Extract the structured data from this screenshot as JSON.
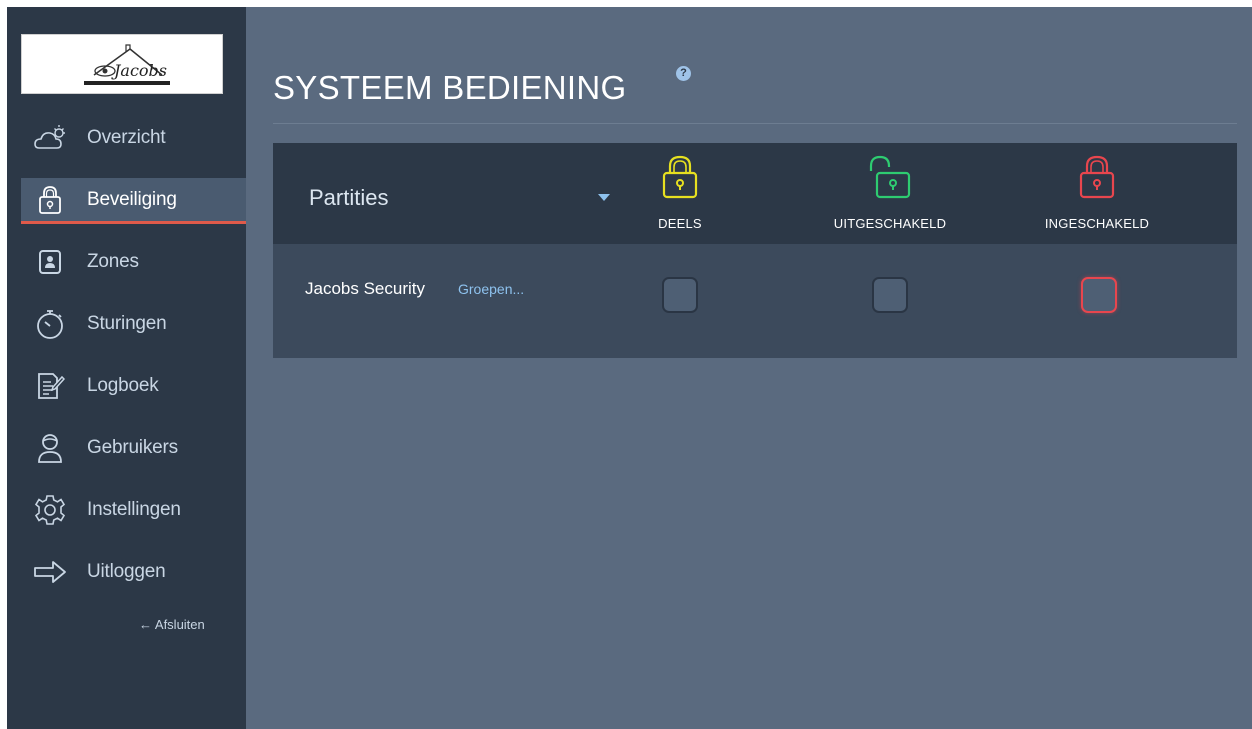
{
  "logo": {
    "text": "Jacobs"
  },
  "sidebar": {
    "items": [
      {
        "label": "Overzicht",
        "icon": "weather-icon"
      },
      {
        "label": "Beveiliging",
        "icon": "lock-icon",
        "active": true
      },
      {
        "label": "Zones",
        "icon": "zone-icon"
      },
      {
        "label": "Sturingen",
        "icon": "timer-icon"
      },
      {
        "label": "Logboek",
        "icon": "log-icon"
      },
      {
        "label": "Gebruikers",
        "icon": "user-icon"
      },
      {
        "label": "Instellingen",
        "icon": "gear-icon"
      },
      {
        "label": "Uitloggen",
        "icon": "logout-arrow-icon"
      }
    ],
    "close_label": "← Afsluiten"
  },
  "header": {
    "title": "SYSTEEM BEDIENING",
    "help": "?"
  },
  "panel": {
    "partities_label": "Partities",
    "modes": [
      {
        "label": "DEELS",
        "color": "#e6e020",
        "state": "closed-lock"
      },
      {
        "label": "UITGESCHAKELD",
        "color": "#2ecc71",
        "state": "open-lock"
      },
      {
        "label": "INGESCHAKELD",
        "color": "#e8464e",
        "state": "closed-lock"
      }
    ],
    "rows": [
      {
        "name": "Jacobs Security",
        "link": "Groepen...",
        "selected_mode": "INGESCHAKELD"
      }
    ]
  },
  "colors": {
    "accent": "#e05a4a",
    "link": "#8ec2ee",
    "armed": "#e8464e"
  }
}
